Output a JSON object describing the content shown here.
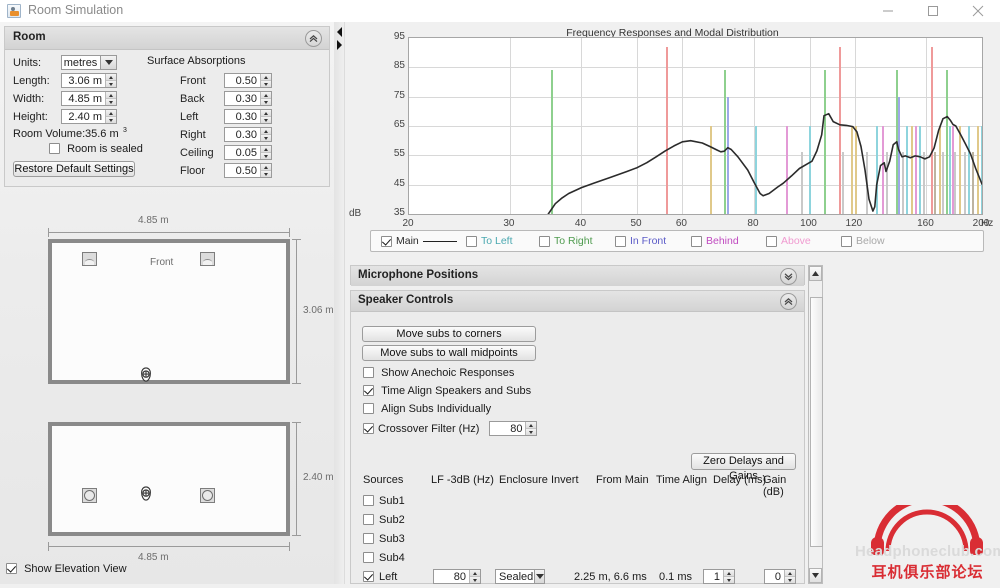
{
  "window": {
    "title": "Room Simulation",
    "icon": "app-icon",
    "minimize": "minimize-icon",
    "maximize": "maximize-icon",
    "close": "close-icon"
  },
  "room_panel": {
    "title": "Room",
    "units_label": "Units:",
    "units_value": "metres",
    "length_label": "Length:",
    "length_value": "3.06 m",
    "width_label": "Width:",
    "width_value": "4.85 m",
    "height_label": "Height:",
    "height_value": "2.40 m",
    "volume_label": "Room Volume:",
    "volume_value": "35.6 m",
    "volume_exp": "3",
    "sealed_label": "Room is sealed",
    "sealed_checked": false,
    "restore_label": "Restore Default Settings",
    "absorptions_title": "Surface Absorptions",
    "absorptions": [
      {
        "label": "Front",
        "value": "0.50"
      },
      {
        "label": "Back",
        "value": "0.30"
      },
      {
        "label": "Left",
        "value": "0.30"
      },
      {
        "label": "Right",
        "value": "0.30"
      },
      {
        "label": "Ceiling",
        "value": "0.05"
      },
      {
        "label": "Floor",
        "value": "0.50"
      }
    ]
  },
  "plan_view": {
    "width_dim": "4.85 m",
    "depth_dim": "3.06 m",
    "front_label": "Front"
  },
  "elevation_view": {
    "width_dim": "4.85 m",
    "height_dim": "2.40 m"
  },
  "show_elevation": {
    "label": "Show Elevation View",
    "checked": true
  },
  "chart_data": {
    "type": "line",
    "title": "Frequency Responses and Modal Distribution",
    "xlabel": "Hz",
    "ylabel": "dB",
    "xscale": "log",
    "xlim": [
      20,
      200
    ],
    "ylim": [
      35,
      95
    ],
    "xticks": [
      20,
      30,
      40,
      50,
      60,
      80,
      100,
      120,
      160,
      200
    ],
    "yticks": [
      35,
      45,
      55,
      65,
      75,
      85,
      95
    ],
    "grid": true,
    "legend_position": "below",
    "series": [
      {
        "name": "Main",
        "color": "#2b2b2b",
        "checked": true,
        "x": [
          35.0,
          36,
          37,
          38,
          40,
          42,
          45,
          48,
          50,
          52,
          54,
          56,
          58,
          60,
          62,
          65,
          67,
          69,
          70,
          71,
          72,
          73,
          75,
          78,
          80,
          82,
          83,
          85,
          88,
          90,
          93,
          96,
          99,
          101,
          103,
          105,
          106,
          108,
          110,
          113,
          116,
          119,
          121,
          123,
          125,
          127,
          129,
          130,
          131,
          133,
          135,
          136,
          138,
          140,
          142,
          143,
          145,
          147,
          150,
          153,
          156,
          159,
          162,
          165,
          168,
          171,
          174,
          176,
          178,
          180,
          183,
          187,
          191,
          195,
          200
        ],
        "y": [
          35.0,
          38.5,
          40.5,
          42.0,
          44.0,
          45.5,
          47.5,
          49.5,
          50.8,
          52.5,
          54.5,
          56.5,
          58.2,
          59.6,
          60.0,
          59.2,
          58.0,
          56.8,
          56.2,
          56.4,
          57.6,
          57.0,
          54.5,
          50.0,
          45.8,
          42.0,
          41.2,
          42.0,
          44.2,
          45.5,
          48.0,
          50.5,
          52.0,
          53.0,
          56.5,
          62.0,
          68.5,
          69.2,
          66.5,
          65.4,
          65.2,
          64.8,
          63.0,
          58.0,
          50.0,
          40.0,
          36.0,
          37.5,
          45.0,
          51.5,
          52.5,
          49.5,
          53.0,
          58.6,
          59.6,
          57.0,
          54.5,
          54.8,
          54.2,
          54.8,
          54.5,
          53.8,
          54.5,
          57.5,
          63.5,
          67.5,
          68.2,
          67.0,
          65.5,
          65.0,
          62.5,
          59.0,
          55.5,
          50.5,
          45.2
        ]
      }
    ],
    "legend_items": [
      {
        "label": "Main",
        "color": "#2b2b2b",
        "checked": true,
        "has_line": true
      },
      {
        "label": "To Left",
        "color": "#4aa8b0",
        "checked": false,
        "has_line": false
      },
      {
        "label": "To Right",
        "color": "#4f9b4f",
        "checked": false,
        "has_line": false
      },
      {
        "label": "In Front",
        "color": "#5b5bc8",
        "checked": false,
        "has_line": false
      },
      {
        "label": "Behind",
        "color": "#c04ac0",
        "checked": false,
        "has_line": false
      },
      {
        "label": "Above",
        "color": "#f09ad0",
        "checked": false,
        "has_line": false
      },
      {
        "label": "Below",
        "color": "#a8a8a8",
        "checked": false,
        "has_line": false
      }
    ],
    "modal_lines": [
      {
        "f": 35.4,
        "top": 84,
        "color": "#8ed08e"
      },
      {
        "f": 56.2,
        "top": 92,
        "color": "#ef9a9a"
      },
      {
        "f": 67.0,
        "top": 65,
        "color": "#e0c98a"
      },
      {
        "f": 70.8,
        "top": 84,
        "color": "#8ed08e"
      },
      {
        "f": 71.8,
        "top": 75,
        "color": "#9fa8e8"
      },
      {
        "f": 80.2,
        "top": 65,
        "color": "#8ed4dd"
      },
      {
        "f": 91.0,
        "top": 65,
        "color": "#e39ad6"
      },
      {
        "f": 96.5,
        "top": 56,
        "color": "#c9c9c9"
      },
      {
        "f": 99.8,
        "top": 65,
        "color": "#8ed4dd"
      },
      {
        "f": 106.0,
        "top": 84,
        "color": "#8ed08e"
      },
      {
        "f": 112.5,
        "top": 92,
        "color": "#ef9a9a"
      },
      {
        "f": 114.0,
        "top": 56,
        "color": "#c9c9c9"
      },
      {
        "f": 118.0,
        "top": 65,
        "color": "#e0c98a"
      },
      {
        "f": 120.0,
        "top": 65,
        "color": "#e0c98a"
      },
      {
        "f": 125.5,
        "top": 56,
        "color": "#c9c9c9"
      },
      {
        "f": 130.5,
        "top": 65,
        "color": "#8ed4dd"
      },
      {
        "f": 134.0,
        "top": 65,
        "color": "#e39ad6"
      },
      {
        "f": 136.0,
        "top": 56,
        "color": "#c9c9c9"
      },
      {
        "f": 141.5,
        "top": 84,
        "color": "#8ed08e"
      },
      {
        "f": 142.8,
        "top": 75,
        "color": "#9fa8e8"
      },
      {
        "f": 145.0,
        "top": 56,
        "color": "#c9c9c9"
      },
      {
        "f": 147.5,
        "top": 65,
        "color": "#8ed4dd"
      },
      {
        "f": 150.5,
        "top": 65,
        "color": "#e0c98a"
      },
      {
        "f": 152.5,
        "top": 65,
        "color": "#e39ad6"
      },
      {
        "f": 155.0,
        "top": 65,
        "color": "#8ed4dd"
      },
      {
        "f": 158.0,
        "top": 56,
        "color": "#c9c9c9"
      },
      {
        "f": 163.0,
        "top": 92,
        "color": "#ef9a9a"
      },
      {
        "f": 165.0,
        "top": 56,
        "color": "#bdb3a0"
      },
      {
        "f": 168.0,
        "top": 65,
        "color": "#e0c98a"
      },
      {
        "f": 170.5,
        "top": 56,
        "color": "#c9c9c9"
      },
      {
        "f": 173.0,
        "top": 84,
        "color": "#8ed08e"
      },
      {
        "f": 175.0,
        "top": 65,
        "color": "#8ed4dd"
      },
      {
        "f": 177.0,
        "top": 65,
        "color": "#e39ad6"
      },
      {
        "f": 179.0,
        "top": 56,
        "color": "#c9c9c9"
      },
      {
        "f": 182.5,
        "top": 65,
        "color": "#e0c98a"
      },
      {
        "f": 186.0,
        "top": 56,
        "color": "#c9c9c9"
      },
      {
        "f": 189.0,
        "top": 65,
        "color": "#8ed4dd"
      },
      {
        "f": 192.5,
        "top": 56,
        "color": "#bdb3a0"
      },
      {
        "f": 196.0,
        "top": 65,
        "color": "#e0c98a"
      },
      {
        "f": 199.0,
        "top": 65,
        "color": "#8ed4dd"
      }
    ]
  },
  "mic_section": {
    "title": "Microphone Positions",
    "expand_icon": "chevron-double-down-icon"
  },
  "speaker_section": {
    "title": "Speaker Controls",
    "collapse_icon": "chevron-double-up-icon",
    "move_corners": "Move subs to corners",
    "move_midpoints": "Move subs to wall midpoints",
    "anechoic": {
      "label": "Show Anechoic Responses",
      "checked": false
    },
    "time_align": {
      "label": "Time Align Speakers and Subs",
      "checked": true
    },
    "align_subs": {
      "label": "Align Subs Individually",
      "checked": false
    },
    "crossover": {
      "label": "Crossover Filter (Hz)",
      "checked": true,
      "value": "80"
    },
    "zero_delays": "Zero Delays and Gains"
  },
  "sources_table": {
    "headers": [
      "Sources",
      "LF -3dB (Hz)",
      "Enclosure",
      "Invert",
      "From Main",
      "Time Align",
      "Delay (ms)",
      "Gain (dB)"
    ],
    "rows": [
      {
        "name": "Sub1",
        "checked": false,
        "lf": "",
        "enclosure": "",
        "from_main": "",
        "time_align": "",
        "delay": "",
        "gain": ""
      },
      {
        "name": "Sub2",
        "checked": false,
        "lf": "",
        "enclosure": "",
        "from_main": "",
        "time_align": "",
        "delay": "",
        "gain": ""
      },
      {
        "name": "Sub3",
        "checked": false,
        "lf": "",
        "enclosure": "",
        "from_main": "",
        "time_align": "",
        "delay": "",
        "gain": ""
      },
      {
        "name": "Sub4",
        "checked": false,
        "lf": "",
        "enclosure": "",
        "from_main": "",
        "time_align": "",
        "delay": "",
        "gain": ""
      },
      {
        "name": "Left",
        "checked": true,
        "lf": "80",
        "enclosure": "Sealed",
        "from_main": "2.25 m, 6.6 ms",
        "time_align": "0.1 ms",
        "delay": "1",
        "gain": "0"
      }
    ]
  },
  "watermark": {
    "text": "Headphoneclub.com",
    "cn": "耳机俱乐部论坛"
  }
}
